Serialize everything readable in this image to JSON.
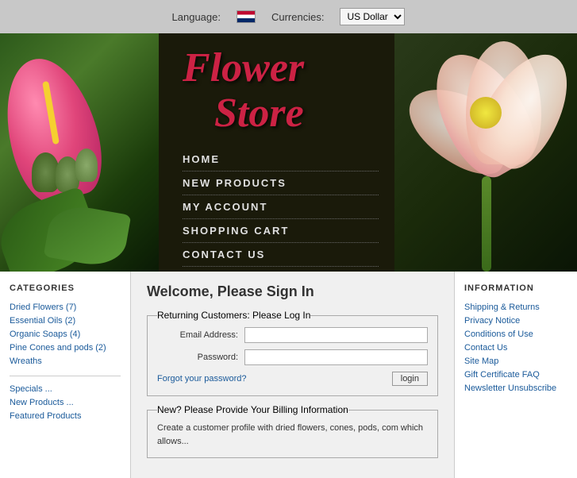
{
  "topbar": {
    "language_label": "Language:",
    "currencies_label": "Currencies:",
    "currency_value": "US Dollar"
  },
  "nav": {
    "items": [
      {
        "label": "HOME",
        "href": "#"
      },
      {
        "label": "NEW PRODUCTS",
        "href": "#"
      },
      {
        "label": "MY ACCOUNT",
        "href": "#"
      },
      {
        "label": "SHOPPING CART",
        "href": "#"
      },
      {
        "label": "CONTACT US",
        "href": "#"
      }
    ]
  },
  "banner": {
    "title_line1": "Flower",
    "title_line2": "Store"
  },
  "sidebar_left": {
    "categories_heading": "CATEGORIES",
    "categories": [
      {
        "label": "Dried Flowers (7)",
        "href": "#"
      },
      {
        "label": "Essential Oils (2)",
        "href": "#"
      },
      {
        "label": "Organic Soaps (4)",
        "href": "#"
      },
      {
        "label": "Pine Cones and pods (2)",
        "href": "#"
      },
      {
        "label": "Wreaths",
        "href": "#"
      }
    ],
    "links": [
      {
        "label": "Specials ...",
        "href": "#"
      },
      {
        "label": "New Products ...",
        "href": "#"
      },
      {
        "label": "Featured Products",
        "href": "#"
      }
    ]
  },
  "main": {
    "welcome_heading": "Welcome, Please Sign In",
    "returning_legend": "Returning Customers: Please Log In",
    "email_label": "Email Address:",
    "password_label": "Password:",
    "forgot_text": "Forgot your password?",
    "login_button": "login",
    "new_customer_legend": "New? Please Provide Your Billing Information",
    "new_customer_text": "Create a customer profile with dried flowers, cones, pods, com which allows..."
  },
  "sidebar_right": {
    "info_heading": "INFORMATION",
    "links": [
      {
        "label": "Shipping & Returns",
        "href": "#"
      },
      {
        "label": "Privacy Notice",
        "href": "#"
      },
      {
        "label": "Conditions of Use",
        "href": "#"
      },
      {
        "label": "Contact Us",
        "href": "#"
      },
      {
        "label": "Site Map",
        "href": "#"
      },
      {
        "label": "Gift Certificate FAQ",
        "href": "#"
      },
      {
        "label": "Newsletter Unsubscribe",
        "href": "#"
      }
    ]
  }
}
